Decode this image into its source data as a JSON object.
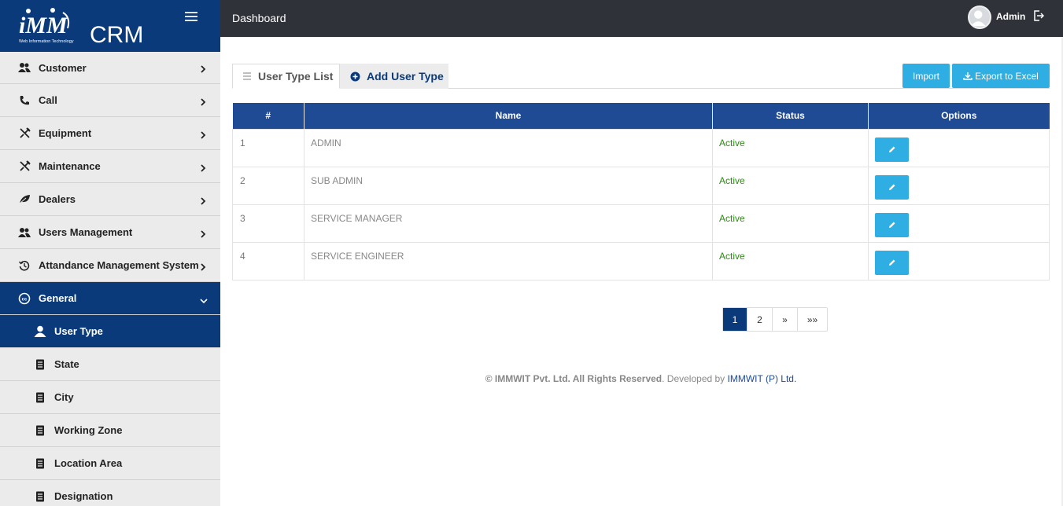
{
  "brand": {
    "logo_text": "CRM",
    "logo_sub": "Web Information Technology"
  },
  "header": {
    "title": "Dashboard",
    "user": "Admin"
  },
  "sidebar": {
    "items": [
      {
        "label": "Customer",
        "icon": "users-icon"
      },
      {
        "label": "Call",
        "icon": "phone-icon"
      },
      {
        "label": "Equipment",
        "icon": "tools-icon"
      },
      {
        "label": "Maintenance",
        "icon": "tools-icon"
      },
      {
        "label": "Dealers",
        "icon": "leaf-icon"
      },
      {
        "label": "Users Management",
        "icon": "users-icon"
      },
      {
        "label": "Attandance Management System",
        "icon": "history-icon"
      },
      {
        "label": "General",
        "icon": "cc-icon"
      }
    ],
    "sub_items": [
      {
        "label": "User Type",
        "icon": "user-icon"
      },
      {
        "label": "State",
        "icon": "document-icon"
      },
      {
        "label": "City",
        "icon": "document-icon"
      },
      {
        "label": "Working Zone",
        "icon": "document-icon"
      },
      {
        "label": "Location Area",
        "icon": "document-icon"
      },
      {
        "label": "Designation",
        "icon": "document-icon"
      }
    ]
  },
  "tabs": {
    "list": "User Type List",
    "add": "Add User Type"
  },
  "actions": {
    "import": "Import",
    "export": "Export to Excel"
  },
  "table": {
    "headers": [
      "#",
      "Name",
      "Status",
      "Options"
    ],
    "rows": [
      {
        "num": "1",
        "name": "ADMIN",
        "status": "Active"
      },
      {
        "num": "2",
        "name": "SUB ADMIN",
        "status": "Active"
      },
      {
        "num": "3",
        "name": "SERVICE MANAGER",
        "status": "Active"
      },
      {
        "num": "4",
        "name": "SERVICE ENGINEER",
        "status": "Active"
      }
    ]
  },
  "pagination": {
    "pages": [
      "1",
      "2",
      "»",
      "»»"
    ],
    "current": "1"
  },
  "footer": {
    "copyright": "© IMMWIT Pvt. Ltd. All Rights Reserved",
    "dev_prefix": ". Developed by ",
    "dev_name": "IMMWIT (P) Ltd."
  },
  "colors": {
    "sidebar_active": "#0a3a7a",
    "header": "#2f3238",
    "table_head": "#1f4a94",
    "button": "#2eaee2",
    "status_active": "#2c8a12"
  }
}
